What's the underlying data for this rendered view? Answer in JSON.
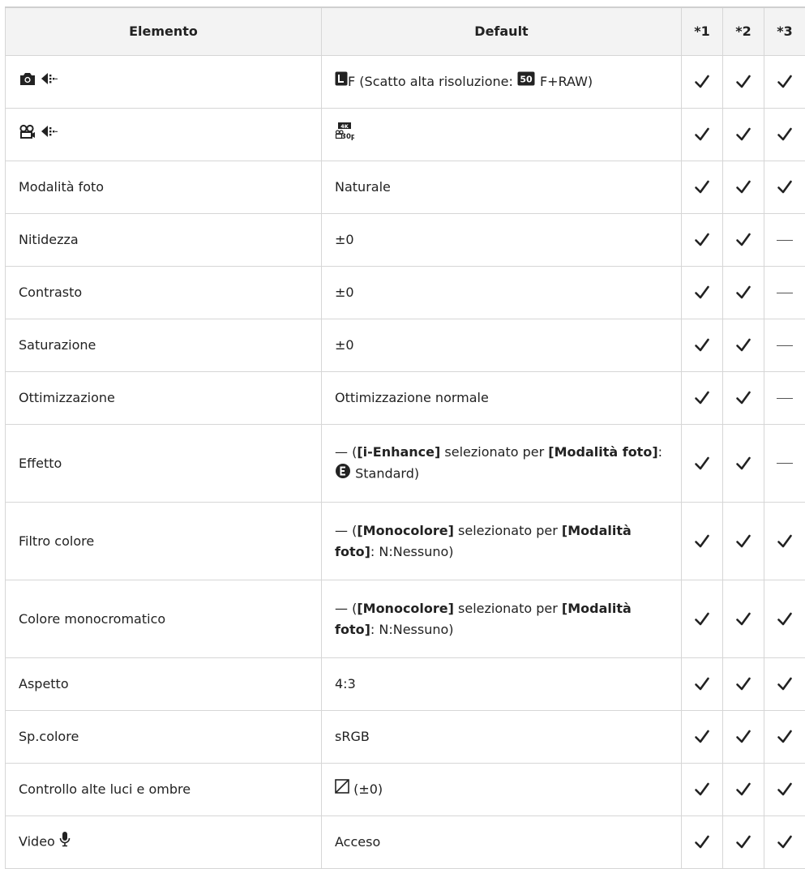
{
  "headers": {
    "item": "Elemento",
    "default": "Default",
    "c1": "*1",
    "c2": "*2",
    "c3": "*3"
  },
  "rows": [
    {
      "item_icons": [
        "camera-icon",
        "quality-icon"
      ],
      "default_icon": "large-fine-icon",
      "default_text": "F (Scatto alta risoluzione: ",
      "default_icon2": "50m-icon",
      "default_text2": "F+RAW)",
      "checks": [
        true,
        true,
        true
      ]
    },
    {
      "item_icons": [
        "movie-icon",
        "quality-icon"
      ],
      "default_icon": "4k-30p-icon",
      "checks": [
        true,
        true,
        true
      ]
    },
    {
      "item": "Modalità foto",
      "default": "Naturale",
      "checks": [
        true,
        true,
        true
      ]
    },
    {
      "item": "Nitidezza",
      "default": "±0",
      "checks": [
        true,
        true,
        false
      ]
    },
    {
      "item": "Contrasto",
      "default": "±0",
      "checks": [
        true,
        true,
        false
      ]
    },
    {
      "item": "Saturazione",
      "default": "±0",
      "checks": [
        true,
        true,
        false
      ]
    },
    {
      "item": "Ottimizzazione",
      "default": "Ottimizzazione normale",
      "checks": [
        true,
        true,
        false
      ]
    },
    {
      "item": "Effetto",
      "default_p1": "— (",
      "default_b1": "[i-Enhance]",
      "default_p2": " selezionato per ",
      "default_b2": "[Modalità foto]",
      "default_p3": ": ",
      "default_icon": "e-circle-icon",
      "default_p4": " Standard)",
      "checks": [
        true,
        true,
        false
      ]
    },
    {
      "item": "Filtro colore",
      "default_p1": "— (",
      "default_b1": "[Monocolore]",
      "default_p2": " selezionato per ",
      "default_b2": "[Modalità foto]",
      "default_p3": ": N:Nessuno)",
      "checks": [
        true,
        true,
        true
      ]
    },
    {
      "item": "Colore monocromatico",
      "default_p1": "— (",
      "default_b1": "[Monocolore]",
      "default_p2": " selezionato per ",
      "default_b2": "[Modalità foto]",
      "default_p3": ": N:Nessuno)",
      "checks": [
        true,
        true,
        true
      ]
    },
    {
      "item": "Aspetto",
      "default": "4:3",
      "checks": [
        true,
        true,
        true
      ]
    },
    {
      "item": "Sp.colore",
      "default": "sRGB",
      "checks": [
        true,
        true,
        true
      ]
    },
    {
      "item": "Controllo alte luci e ombre",
      "default_icon": "tone-curve-icon",
      "default": "(±0)",
      "checks": [
        true,
        true,
        true
      ]
    },
    {
      "item": "Video",
      "item_icon": "microphone-icon",
      "default": "Acceso",
      "checks": [
        true,
        true,
        true
      ]
    }
  ]
}
